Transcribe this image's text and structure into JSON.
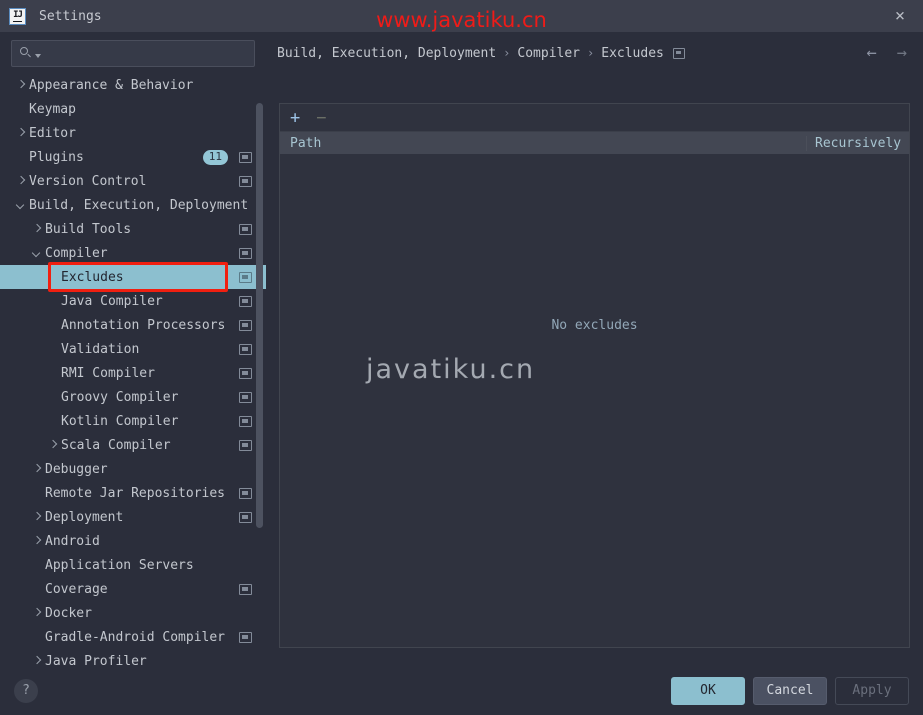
{
  "window": {
    "title": "Settings",
    "logo_text": "IJ",
    "close_icon": "×"
  },
  "watermarks": {
    "top": "www.javatiku.cn",
    "center": "javatiku.cn"
  },
  "search": {
    "value": "",
    "placeholder": ""
  },
  "sidebar": {
    "items": [
      {
        "label": "Appearance & Behavior",
        "indent": 0,
        "arrow": "right",
        "icon": false,
        "badge": null,
        "selected": false
      },
      {
        "label": "Keymap",
        "indent": 0,
        "arrow": "none",
        "icon": false,
        "badge": null,
        "selected": false
      },
      {
        "label": "Editor",
        "indent": 0,
        "arrow": "right",
        "icon": false,
        "badge": null,
        "selected": false
      },
      {
        "label": "Plugins",
        "indent": 0,
        "arrow": "none",
        "icon": true,
        "badge": "11",
        "selected": false
      },
      {
        "label": "Version Control",
        "indent": 0,
        "arrow": "right",
        "icon": true,
        "badge": null,
        "selected": false
      },
      {
        "label": "Build, Execution, Deployment",
        "indent": 0,
        "arrow": "down",
        "icon": false,
        "badge": null,
        "selected": false
      },
      {
        "label": "Build Tools",
        "indent": 1,
        "arrow": "right",
        "icon": true,
        "badge": null,
        "selected": false
      },
      {
        "label": "Compiler",
        "indent": 1,
        "arrow": "down",
        "icon": true,
        "badge": null,
        "selected": false
      },
      {
        "label": "Excludes",
        "indent": 2,
        "arrow": "none",
        "icon": true,
        "badge": null,
        "selected": true
      },
      {
        "label": "Java Compiler",
        "indent": 2,
        "arrow": "none",
        "icon": true,
        "badge": null,
        "selected": false
      },
      {
        "label": "Annotation Processors",
        "indent": 2,
        "arrow": "none",
        "icon": true,
        "badge": null,
        "selected": false
      },
      {
        "label": "Validation",
        "indent": 2,
        "arrow": "none",
        "icon": true,
        "badge": null,
        "selected": false
      },
      {
        "label": "RMI Compiler",
        "indent": 2,
        "arrow": "none",
        "icon": true,
        "badge": null,
        "selected": false
      },
      {
        "label": "Groovy Compiler",
        "indent": 2,
        "arrow": "none",
        "icon": true,
        "badge": null,
        "selected": false
      },
      {
        "label": "Kotlin Compiler",
        "indent": 2,
        "arrow": "none",
        "icon": true,
        "badge": null,
        "selected": false
      },
      {
        "label": "Scala Compiler",
        "indent": 2,
        "arrow": "right",
        "icon": true,
        "badge": null,
        "selected": false
      },
      {
        "label": "Debugger",
        "indent": 1,
        "arrow": "right",
        "icon": false,
        "badge": null,
        "selected": false
      },
      {
        "label": "Remote Jar Repositories",
        "indent": 1,
        "arrow": "none",
        "icon": true,
        "badge": null,
        "selected": false
      },
      {
        "label": "Deployment",
        "indent": 1,
        "arrow": "right",
        "icon": true,
        "badge": null,
        "selected": false
      },
      {
        "label": "Android",
        "indent": 1,
        "arrow": "right",
        "icon": false,
        "badge": null,
        "selected": false
      },
      {
        "label": "Application Servers",
        "indent": 1,
        "arrow": "none",
        "icon": false,
        "badge": null,
        "selected": false
      },
      {
        "label": "Coverage",
        "indent": 1,
        "arrow": "none",
        "icon": true,
        "badge": null,
        "selected": false
      },
      {
        "label": "Docker",
        "indent": 1,
        "arrow": "right",
        "icon": false,
        "badge": null,
        "selected": false
      },
      {
        "label": "Gradle-Android Compiler",
        "indent": 1,
        "arrow": "none",
        "icon": true,
        "badge": null,
        "selected": false
      },
      {
        "label": "Java Profiler",
        "indent": 1,
        "arrow": "right",
        "icon": false,
        "badge": null,
        "selected": false
      }
    ]
  },
  "breadcrumb": {
    "parts": [
      "Build, Execution, Deployment",
      "Compiler",
      "Excludes"
    ],
    "separator": "›"
  },
  "nav": {
    "back_icon": "←",
    "forward_icon": "→"
  },
  "toolbar": {
    "add_label": "+",
    "remove_label": "−"
  },
  "table": {
    "columns": [
      "Path",
      "Recursively"
    ],
    "rows": [],
    "empty_text": "No excludes"
  },
  "footer": {
    "help_label": "?",
    "ok_label": "OK",
    "cancel_label": "Cancel",
    "apply_label": "Apply"
  },
  "colors": {
    "accent": "#8cbfcf",
    "background": "#2b2e3b",
    "titlebar": "#3c3f4c",
    "annotation": "#f01f10",
    "watermark_red": "#ef1b18"
  }
}
